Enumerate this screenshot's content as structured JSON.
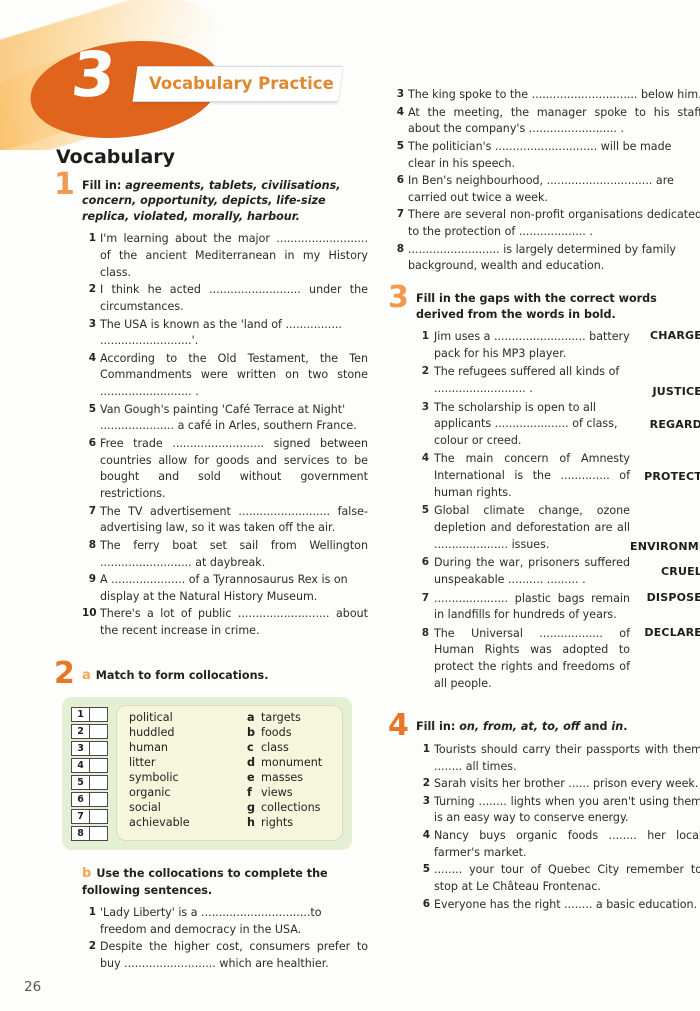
{
  "header": {
    "chapter_number": "3",
    "banner_title": "Vocabulary Practice",
    "accent_orange": "#e1641c",
    "banner_text_color": "#e1872f"
  },
  "page_number": "26",
  "left_column": {
    "section_title": "Vocabulary",
    "exercise1": {
      "number": "1",
      "rubric": "Fill in: agreements, tablets, civilisations, concern, opportunity, depicts, life-size replica, violated, morally, harbour.",
      "items": [
        "I'm learning about the major .......................... of the ancient Mediterranean in my History class.",
        "I think he acted .......................... under the circumstances.",
        "The USA is known as the 'land of ................ ..........................'.",
        "According to the Old Testament, the Ten Commandments were written on two stone .......................... .",
        "Van Gough's painting 'Café Terrace at Night' ..................... a café in Arles, southern France.",
        "Free trade .......................... signed between countries allow for goods and services to be bought and sold without government restrictions.",
        "The TV advertisement .......................... false-advertising law, so it was taken off the air.",
        "The ferry boat set sail from Wellington .......................... at daybreak.",
        "A ..................... of a Tyrannosaurus Rex is on display at the Natural History Museum.",
        "There's a lot of public .......................... about the recent increase in crime."
      ]
    },
    "exercise2": {
      "number": "2",
      "part_a_letter": "a",
      "part_a_rubric": "Match to form collocations.",
      "left_items": [
        {
          "num": "1",
          "text": "political"
        },
        {
          "num": "2",
          "text": "huddled"
        },
        {
          "num": "3",
          "text": "human"
        },
        {
          "num": "4",
          "text": "litter"
        },
        {
          "num": "5",
          "text": "symbolic"
        },
        {
          "num": "6",
          "text": "organic"
        },
        {
          "num": "7",
          "text": "social"
        },
        {
          "num": "8",
          "text": "achievable"
        }
      ],
      "right_items": [
        {
          "letter": "a",
          "text": "targets"
        },
        {
          "letter": "b",
          "text": "foods"
        },
        {
          "letter": "c",
          "text": "class"
        },
        {
          "letter": "d",
          "text": "monument"
        },
        {
          "letter": "e",
          "text": "masses"
        },
        {
          "letter": "f",
          "text": "views"
        },
        {
          "letter": "g",
          "text": "collections"
        },
        {
          "letter": "h",
          "text": "rights"
        }
      ],
      "part_b_letter": "b",
      "part_b_rubric": "Use the collocations to complete the following sentences.",
      "part_b_items": [
        "'Lady Liberty' is a ...............................to freedom and democracy in the USA.",
        "Despite the higher cost, consumers prefer to buy .......................... which are healthier."
      ]
    }
  },
  "right_column": {
    "exercise1_continued": [
      "The king spoke to the .............................. below him.",
      "At the meeting, the manager spoke to his staff about the company's ......................... .",
      "The politician's ............................. will be made clear in his speech.",
      "In Ben's neighbourhood, .............................. are carried out twice a week.",
      "There are several non-profit organisations dedicated to the protection of ................... .",
      ".......................... is largely determined by family background, wealth and education."
    ],
    "exercise3": {
      "number": "3",
      "rubric": "Fill in the gaps with the correct words derived from the words in bold.",
      "items": [
        {
          "num": "1",
          "text": "Jim uses a .......................... battery pack for his MP3 player.",
          "word": "CHARGE"
        },
        {
          "num": "2",
          "text": "The refugees suffered all kinds of .......................... .",
          "word": "JUSTICE"
        },
        {
          "num": "3",
          "text": "The scholarship is open to all applicants ..................... of class, colour or creed.",
          "word": "REGARD"
        },
        {
          "num": "4",
          "text": "The main concern of Amnesty International is the .............. of human rights.",
          "word": "PROTECT"
        },
        {
          "num": "5",
          "text": "Global climate change, ozone depletion and deforestation are all ..................... issues.",
          "word": "ENVIRONMENT"
        },
        {
          "num": "6",
          "text": "During the war, prisoners suffered unspeakable .......... ......... .",
          "word": "CRUEL"
        },
        {
          "num": "7",
          "text": "..................... plastic bags remain in landfills for hundreds of years.",
          "word": "DISPOSE"
        },
        {
          "num": "8",
          "text": "The Universal .................. of Human Rights was adopted to protect the rights and freedoms of all people.",
          "word": "DECLARE"
        }
      ]
    },
    "exercise4": {
      "number": "4",
      "rubric": "Fill in: on, from, at, to, off and in.",
      "items": [
        "Tourists should carry their passports with them ........ all times.",
        "Sarah visits her brother ...... prison every week.",
        "Turning ........ lights when you aren't using them is an easy way to conserve energy.",
        "Nancy buys organic foods ........ her local farmer's market.",
        "........ your tour of Quebec City remember to stop at Le Château Frontenac.",
        "Everyone has the right ........ a basic education."
      ]
    }
  }
}
